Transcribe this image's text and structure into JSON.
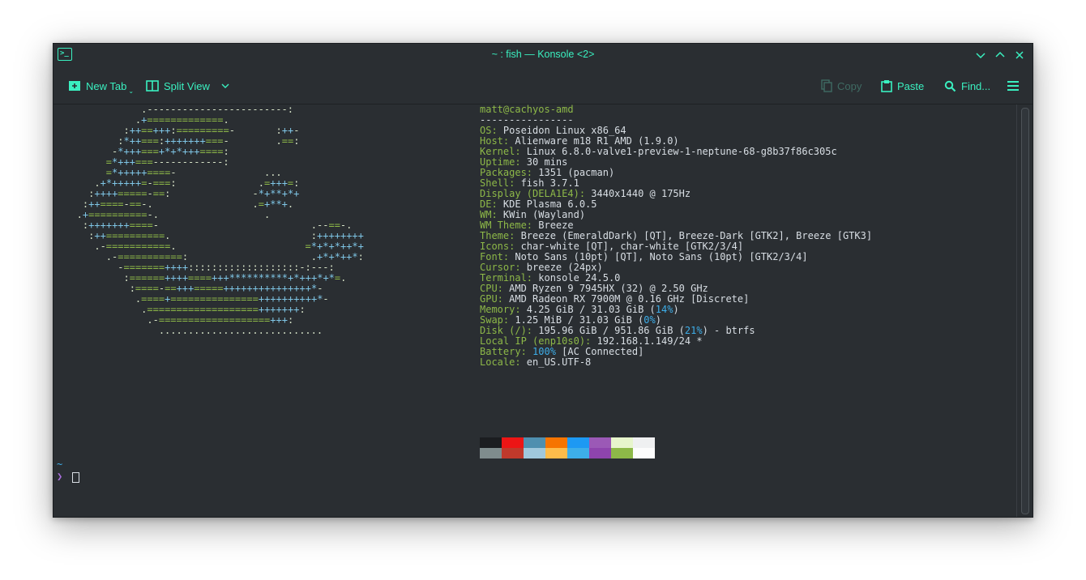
{
  "window": {
    "title": "~ : fish — Konsole <2>"
  },
  "toolbar": {
    "new_tab": "New Tab",
    "split_view": "Split View",
    "copy": "Copy",
    "paste": "Paste",
    "find": "Find..."
  },
  "colors": {
    "accent": "#3af0c0",
    "logo_green": "#8db848",
    "logo_blue": "#7fc6e6",
    "background": "#2a2e32"
  },
  "fastfetch": {
    "header": "matt@cachyos-amd",
    "separator": "----------------",
    "lines": [
      {
        "key": "OS:",
        "value": " Poseidon Linux x86_64"
      },
      {
        "key": "Host:",
        "value": " Alienware m18 R1 AMD (1.9.0)"
      },
      {
        "key": "Kernel:",
        "value": " Linux 6.8.0-valve1-preview-1-neptune-68-g8b37f86c305c"
      },
      {
        "key": "Uptime:",
        "value": " 30 mins"
      },
      {
        "key": "Packages:",
        "value": " 1351 (pacman)"
      },
      {
        "key": "Shell:",
        "value": " fish 3.7.1"
      },
      {
        "key": "Display (DELA1E4):",
        "value": " 3440x1440 @ 175Hz"
      },
      {
        "key": "DE:",
        "value": " KDE Plasma 6.0.5"
      },
      {
        "key": "WM:",
        "value": " KWin (Wayland)"
      },
      {
        "key": "WM Theme:",
        "value": " Breeze"
      },
      {
        "key": "Theme:",
        "value": " Breeze (EmeraldDark) [QT], Breeze-Dark [GTK2], Breeze [GTK3]"
      },
      {
        "key": "Icons:",
        "value": " char-white [QT], char-white [GTK2/3/4]"
      },
      {
        "key": "Font:",
        "value": " Noto Sans (10pt) [QT], Noto Sans (10pt) [GTK2/3/4]"
      },
      {
        "key": "Cursor:",
        "value": " breeze (24px)"
      },
      {
        "key": "Terminal:",
        "value": " konsole 24.5.0"
      },
      {
        "key": "CPU:",
        "value": " AMD Ryzen 9 7945HX (32) @ 2.50 GHz"
      },
      {
        "key": "GPU:",
        "value": " AMD Radeon RX 7900M @ 0.16 GHz [Discrete]"
      },
      {
        "key": "Memory:",
        "value": " 4.25 GiB / 31.03 GiB (",
        "hl": "14%",
        "tail": ")"
      },
      {
        "key": "Swap:",
        "value": " 1.25 MiB / 31.03 GiB (",
        "hl": "0%",
        "tail": ")"
      },
      {
        "key": "Disk (/):",
        "value": " 195.96 GiB / 951.86 GiB (",
        "hl": "21%",
        "tail": ") - btrfs"
      },
      {
        "key": "Local IP (enp10s0):",
        "value": " 192.168.1.149/24 *"
      },
      {
        "key": "Battery:",
        "value": " ",
        "hl": "100%",
        "tail": " [AC Connected]"
      },
      {
        "key": "Locale:",
        "value": " en_US.UTF-8"
      }
    ],
    "palette_top": [
      "#1b1d20",
      "#ed1515",
      "#4f8faf",
      "#f67400",
      "#1d99f3",
      "#9b59b6",
      "#e7f5cc",
      "#eff0f1"
    ],
    "palette_bottom": [
      "#7f8c8d",
      "#c0392b",
      "#a0c8dc",
      "#fdbc4b",
      "#3daee9",
      "#8e44ad",
      "#8db848",
      "#fcfcfc"
    ]
  },
  "ascii_logo": [
    "              .------------------------:",
    "             .+=============.",
    "           :++==+++:=========-       :++-",
    "          :*++===:+++++++===-        .==:",
    "         -*+++===+*+*+++====:",
    "        =*+++===------------:",
    "        =*+++++====-               ...",
    "      .+*+++++=-===:              .=+++=:",
    "     :++++=====-==:              -*+**+*+",
    "    :++====-==-.                 .=+**+.",
    "   .+==========-.                  .",
    "    :+++++++====-                          .--==-.",
    "     :++==========.                        :++++++++",
    "      .-===========.                      =*+*+*++*+",
    "        .-===========:                     .+*+*++*:",
    "          -=======++++:::::::::::::::::::-:---:",
    "           :======++++====+++**********+*+++*+*=.",
    "            :====-==+++=====+++++++++++++++*-",
    "             .====+===============++++++++++*-",
    "              .===================+++++++:",
    "               .-===================+++:",
    "                 ............................"
  ],
  "prompt": {
    "cwd": "~",
    "symbol": "❯"
  }
}
